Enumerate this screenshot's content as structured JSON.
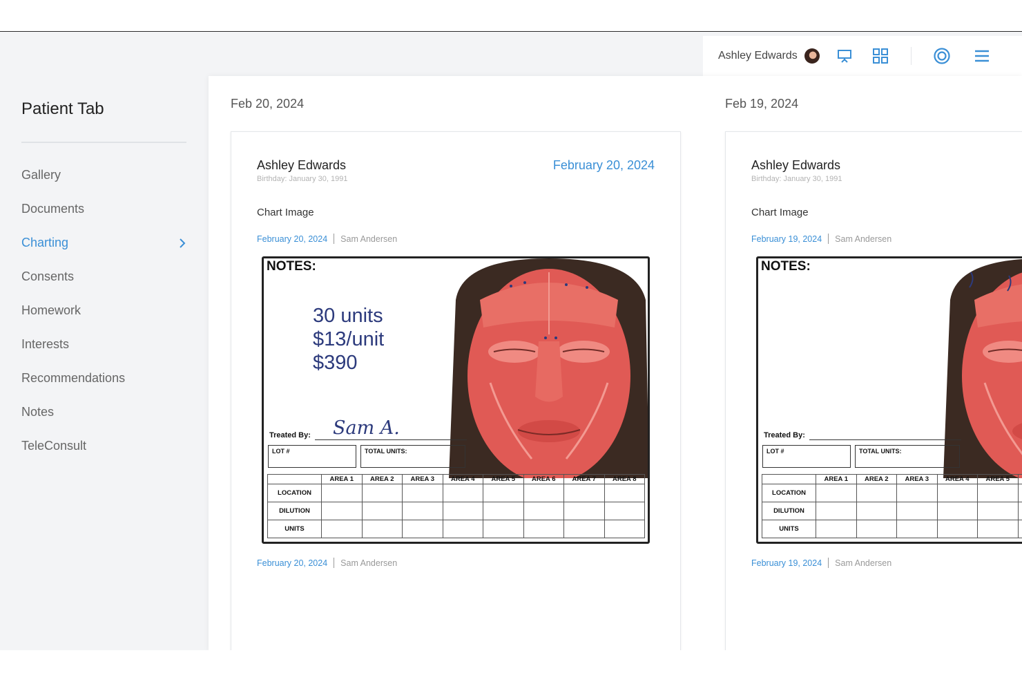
{
  "header": {
    "user_name": "Ashley Edwards",
    "icons": [
      "avatar",
      "presentation-icon",
      "grid-icon",
      "target-icon",
      "menu-icon"
    ]
  },
  "sidebar": {
    "title": "Patient Tab",
    "items": [
      {
        "label": "Gallery"
      },
      {
        "label": "Documents"
      },
      {
        "label": "Charting",
        "active": true
      },
      {
        "label": "Consents"
      },
      {
        "label": "Homework"
      },
      {
        "label": "Interests"
      },
      {
        "label": "Recommendations"
      },
      {
        "label": "Notes"
      },
      {
        "label": "TeleConsult"
      }
    ]
  },
  "columns": [
    {
      "date_heading": "Feb 20, 2024",
      "card": {
        "patient_name": "Ashley Edwards",
        "birthday": "Birthday: January 30, 1991",
        "date_right": "February 20, 2024",
        "section_label": "Chart Image",
        "meta_date": "February 20, 2024",
        "meta_author": "Sam Andersen",
        "sheet": {
          "notes_heading": "NOTES:",
          "note_lines": [
            "30 units",
            "$13/unit",
            "$390"
          ],
          "treated_by": "Treated By:",
          "signature": "Sam A.",
          "lot_label": "LOT #",
          "total_units_label": "TOTAL UNITS:",
          "areas": [
            "AREA 1",
            "AREA 2",
            "AREA 3",
            "AREA 4",
            "AREA 5",
            "AREA 6",
            "AREA 7",
            "AREA 8"
          ],
          "rows": [
            "LOCATION",
            "DILUTION",
            "UNITS"
          ]
        },
        "footer_date": "February 20, 2024",
        "footer_author": "Sam Andersen"
      }
    },
    {
      "date_heading": "Feb 19, 2024",
      "card": {
        "patient_name": "Ashley Edwards",
        "birthday": "Birthday: January 30, 1991",
        "section_label": "Chart Image",
        "meta_date": "February 19, 2024",
        "meta_author": "Sam Andersen",
        "sheet": {
          "notes_heading": "NOTES:",
          "treated_by": "Treated By:",
          "lot_label": "LOT #",
          "total_units_label": "TOTAL UNITS:",
          "areas": [
            "AREA 1",
            "AREA 2",
            "AREA 3",
            "AREA 4",
            "AREA 5"
          ],
          "rows": [
            "LOCATION",
            "DILUTION",
            "UNITS"
          ]
        },
        "footer_date": "February 19, 2024",
        "footer_author": "Sam Andersen"
      }
    }
  ],
  "colors": {
    "accent": "#3a8fd6",
    "face_muscle": "#e05a55",
    "ink": "#2c3a7c"
  }
}
